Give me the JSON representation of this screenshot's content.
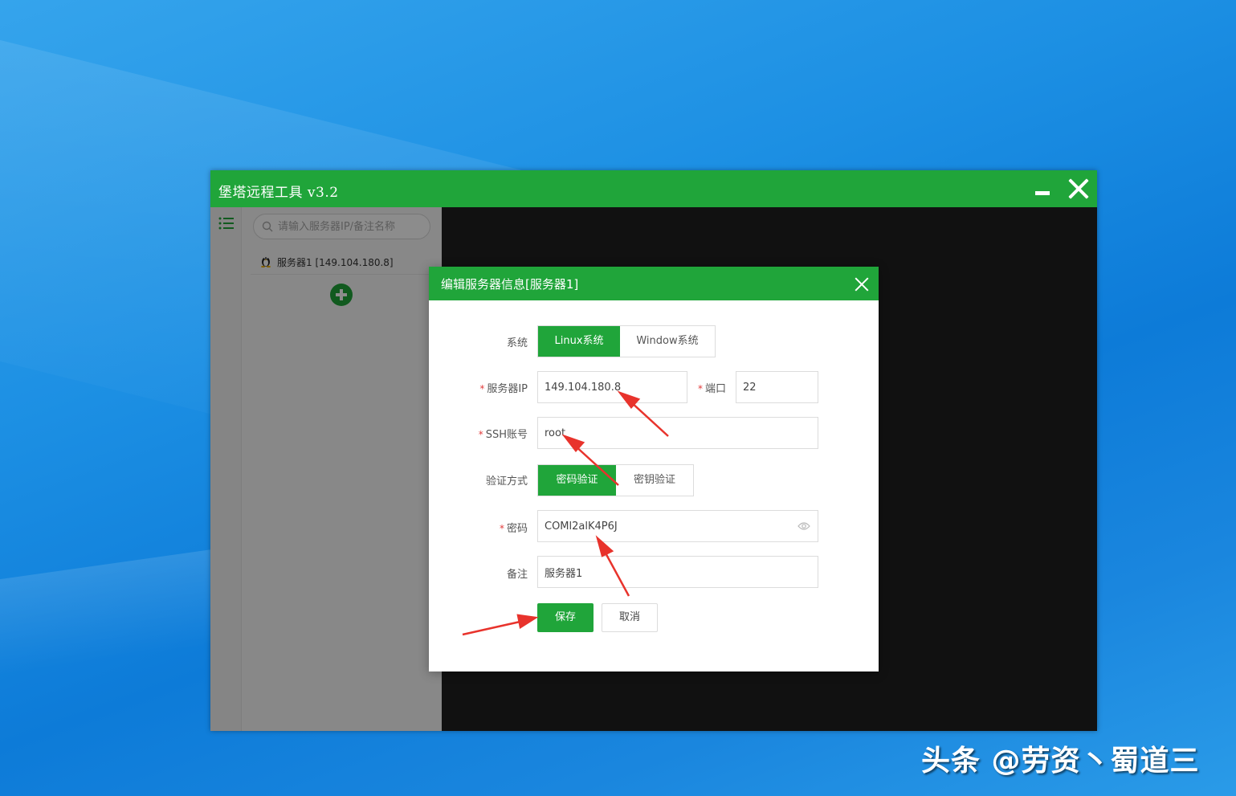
{
  "app": {
    "title": "堡塔远程工具 v3.2"
  },
  "sidebar": {
    "search_placeholder": "请输入服务器IP/备注名称",
    "servers": [
      {
        "label": "服务器1 [149.104.180.8]",
        "os_icon": "linux-penguin-icon"
      }
    ]
  },
  "dialog": {
    "title": "编辑服务器信息[服务器1]",
    "system": {
      "label": "系统",
      "options": [
        "Linux系统",
        "Window系统"
      ],
      "selected": "Linux系统"
    },
    "server_ip": {
      "label": "服务器IP",
      "value": "149.104.180.8",
      "required": true
    },
    "port": {
      "label": "端口",
      "value": "22",
      "required": true
    },
    "ssh_account": {
      "label": "SSH账号",
      "value": "root",
      "required": true
    },
    "auth_method": {
      "label": "验证方式",
      "options": [
        "密码验证",
        "密钥验证"
      ],
      "selected": "密码验证"
    },
    "password": {
      "label": "密码",
      "value": "COMl2alK4P6J",
      "required": true
    },
    "remark": {
      "label": "备注",
      "value": "服务器1"
    },
    "required_mark": "*",
    "save_label": "保存",
    "cancel_label": "取消"
  },
  "watermark": "头条 @劳资丶蜀道三",
  "colors": {
    "accent": "#20a53a",
    "annotation_arrow": "#e8332c"
  }
}
